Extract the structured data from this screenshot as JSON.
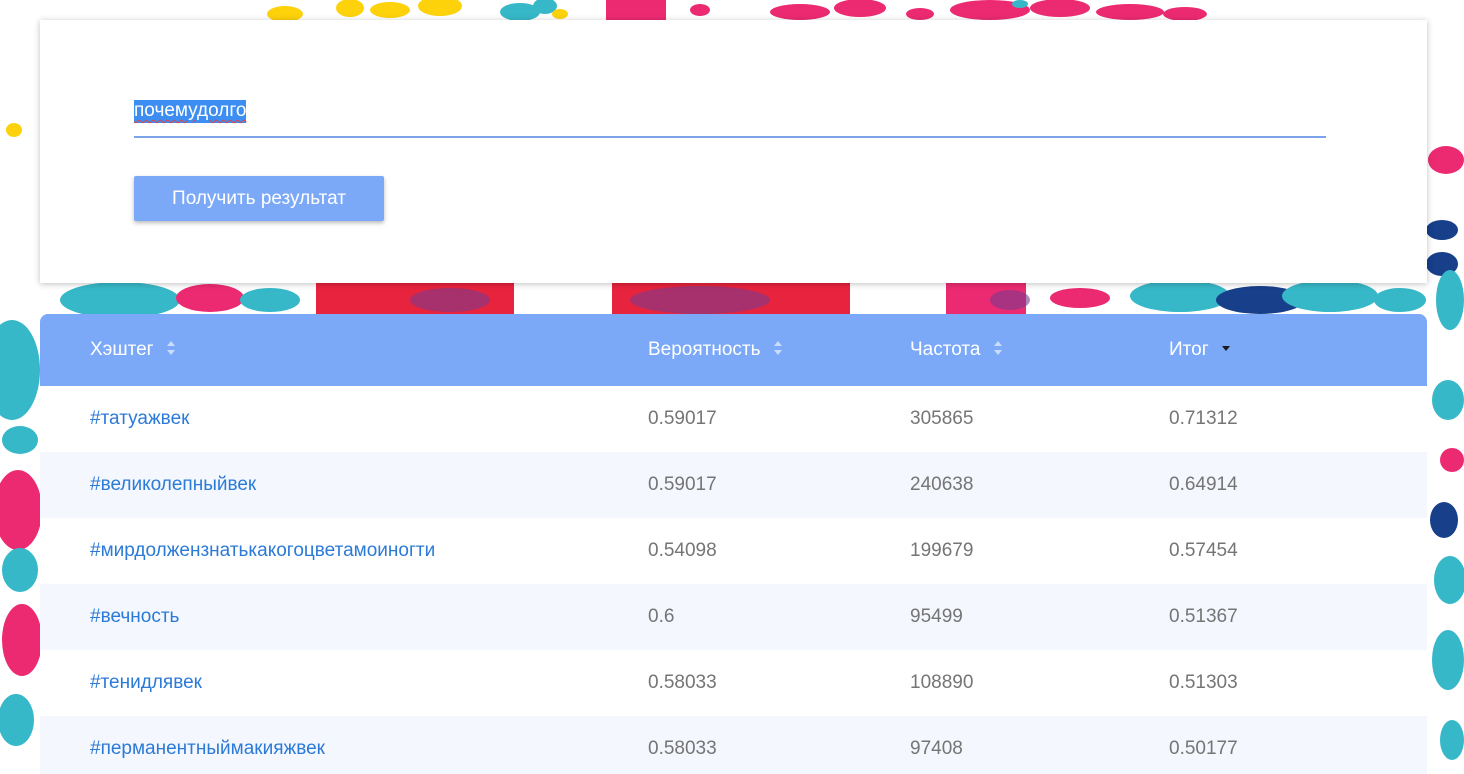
{
  "search": {
    "value": "почемудолго",
    "submit_label": "Получить результат"
  },
  "table": {
    "headers": [
      {
        "label": "Хэштег",
        "sort": "none"
      },
      {
        "label": "Вероятность",
        "sort": "none"
      },
      {
        "label": "Частота",
        "sort": "none"
      },
      {
        "label": "Итог",
        "sort": "desc"
      }
    ],
    "rows": [
      {
        "hashtag": "#татуажвек",
        "probability": "0.59017",
        "frequency": "305865",
        "total": "0.71312"
      },
      {
        "hashtag": "#великолепныйвек",
        "probability": "0.59017",
        "frequency": "240638",
        "total": "0.64914"
      },
      {
        "hashtag": "#мирдолжензнатькакогоцветамоиногти",
        "probability": "0.54098",
        "frequency": "199679",
        "total": "0.57454"
      },
      {
        "hashtag": "#вечность",
        "probability": "0.6",
        "frequency": "95499",
        "total": "0.51367"
      },
      {
        "hashtag": "#тенидлявек",
        "probability": "0.58033",
        "frequency": "108890",
        "total": "0.51303"
      },
      {
        "hashtag": "#перманентныймакияжвек",
        "probability": "0.58033",
        "frequency": "97408",
        "total": "0.50177"
      }
    ]
  },
  "colors": {
    "accent": "#7ba9f8",
    "link": "#2b7ad8",
    "row_alt": "#f4f7fd",
    "splash_pink": "#ec2a72",
    "splash_teal": "#36b8c8",
    "splash_yellow": "#fdd20b",
    "splash_navy": "#173f8a"
  }
}
